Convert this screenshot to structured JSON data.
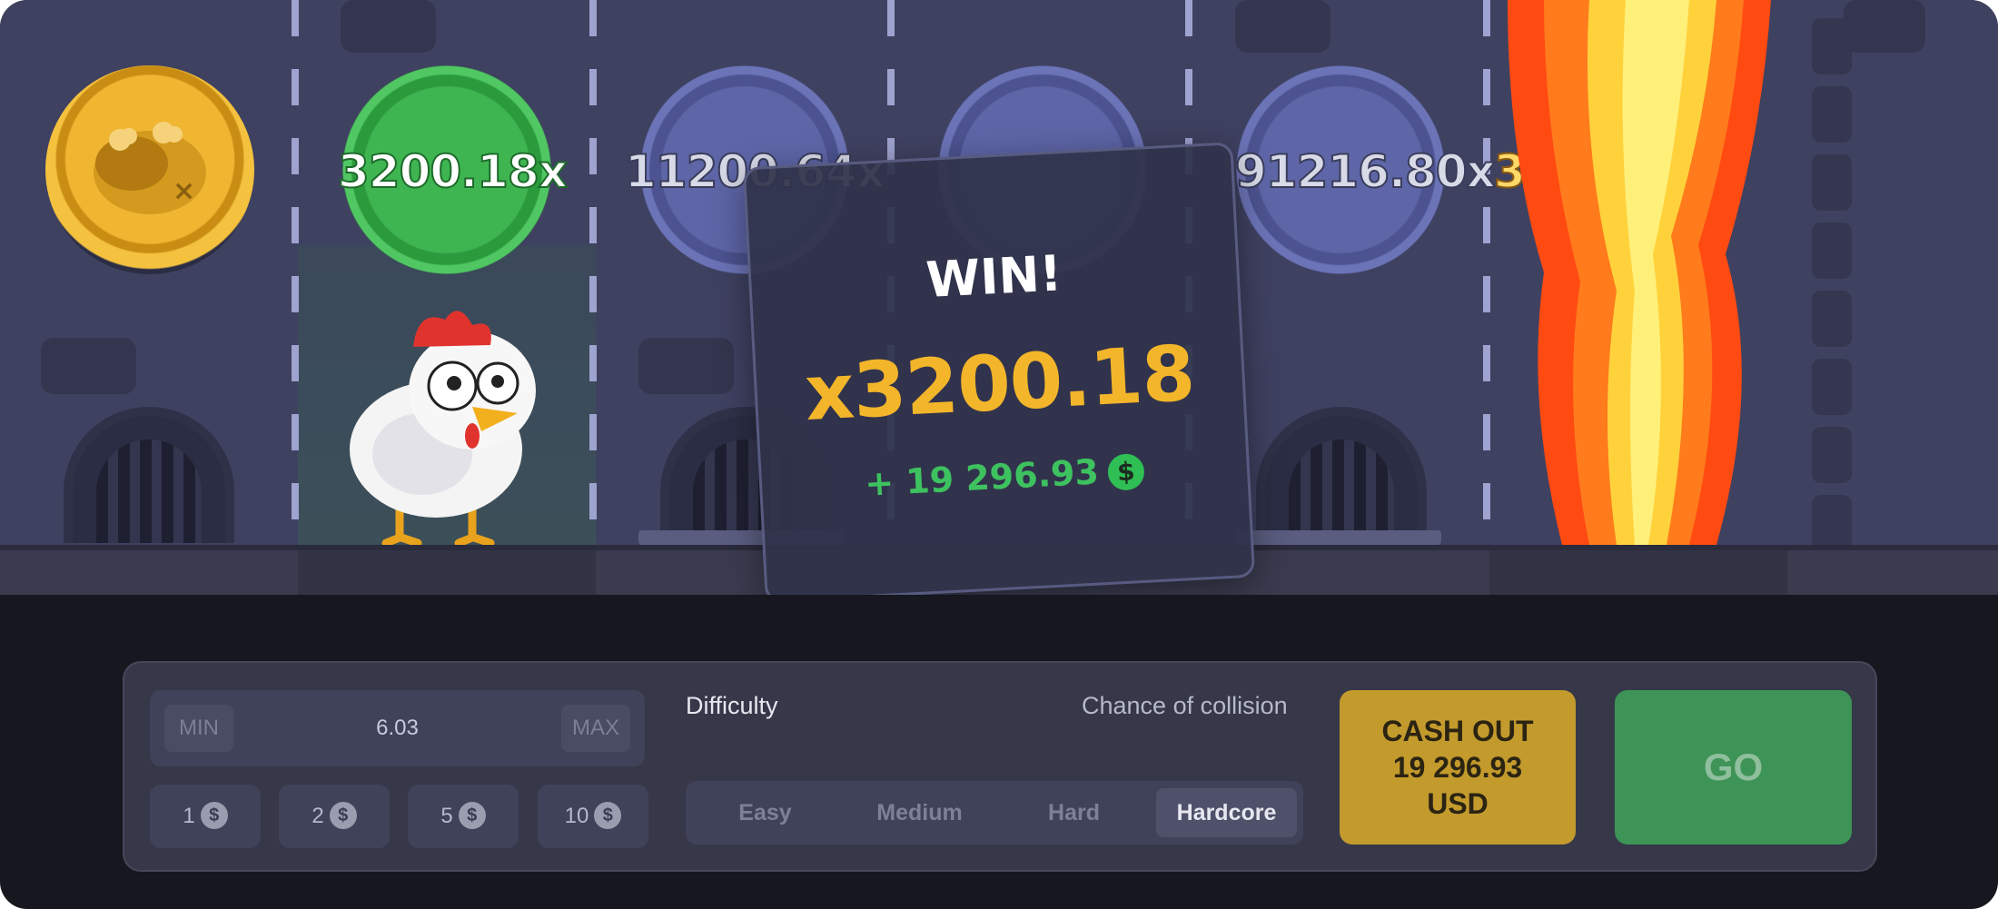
{
  "lanes": {
    "multipliers": [
      "3200.18x",
      "11200.64x",
      "",
      "91216.80x",
      "3203"
    ]
  },
  "win_popup": {
    "title": "WIN!",
    "multiplier": "x3200.18",
    "amount": "+ 19 296.93",
    "currency_icon": "$"
  },
  "bet": {
    "min_label": "MIN",
    "max_label": "MAX",
    "value": "6.03",
    "chips": [
      "1",
      "2",
      "5",
      "10"
    ],
    "chip_icon": "$"
  },
  "difficulty": {
    "label": "Difficulty",
    "collision_label": "Chance of collision",
    "options": [
      "Easy",
      "Medium",
      "Hard",
      "Hardcore"
    ],
    "selected": "Hardcore"
  },
  "actions": {
    "cashout_line1": "CASH OUT",
    "cashout_amount": "19 296.93",
    "cashout_currency": "USD",
    "go_label": "GO"
  },
  "colors": {
    "accent_gold": "#f3b52a",
    "win_green": "#3ec25f",
    "cashout": "#c39a2c",
    "go": "#3e9457"
  }
}
